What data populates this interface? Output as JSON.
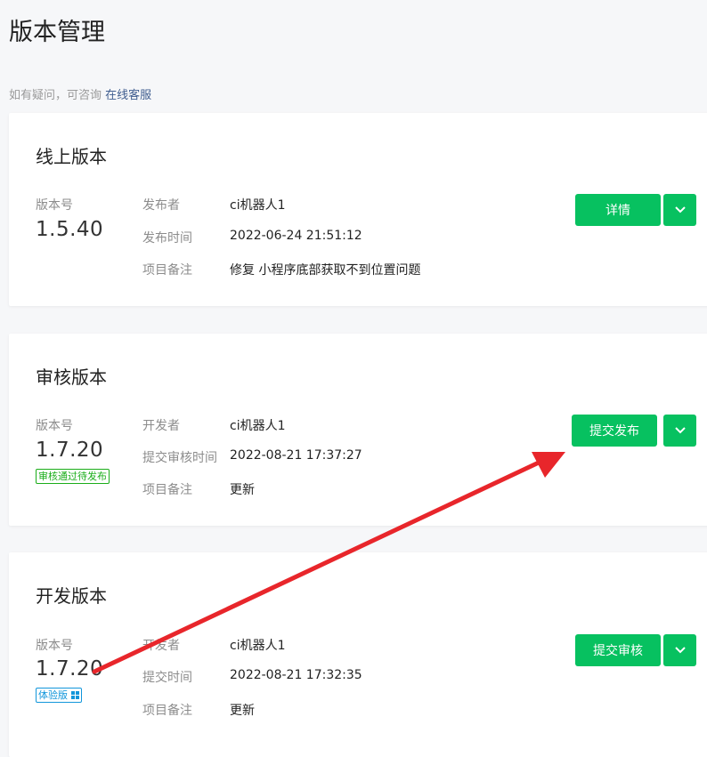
{
  "page": {
    "title": "版本管理",
    "help_text": "如有疑问，可咨询",
    "help_link": "在线客服"
  },
  "online": {
    "title": "线上版本",
    "version_label": "版本号",
    "version": "1.5.40",
    "rows": [
      {
        "label": "发布者",
        "value": "ci机器人1"
      },
      {
        "label": "发布时间",
        "value": "2022-06-24 21:51:12"
      },
      {
        "label": "项目备注",
        "value": "修复 小程序底部获取不到位置问题"
      }
    ],
    "button": "详情"
  },
  "review": {
    "title": "审核版本",
    "version_label": "版本号",
    "version": "1.7.20",
    "badge": "审核通过待发布",
    "rows": [
      {
        "label": "开发者",
        "value": "ci机器人1"
      },
      {
        "label": "提交审核时间",
        "value": "2022-08-21 17:37:27"
      },
      {
        "label": "项目备注",
        "value": "更新"
      }
    ],
    "button": "提交发布"
  },
  "dev": {
    "title": "开发版本",
    "version_label": "版本号",
    "version": "1.7.20",
    "badge": "体验版",
    "rows": [
      {
        "label": "开发者",
        "value": "ci机器人1"
      },
      {
        "label": "提交时间",
        "value": "2022-08-21 17:32:35"
      },
      {
        "label": "项目备注",
        "value": "更新"
      }
    ],
    "button": "提交审核"
  },
  "colors": {
    "primary_green": "#07c160",
    "annotation_red": "#e8262b",
    "link_blue": "#3f5d8f"
  },
  "icons": [
    "chevron-down-icon",
    "qr-code-icon",
    "annotation-arrow"
  ]
}
